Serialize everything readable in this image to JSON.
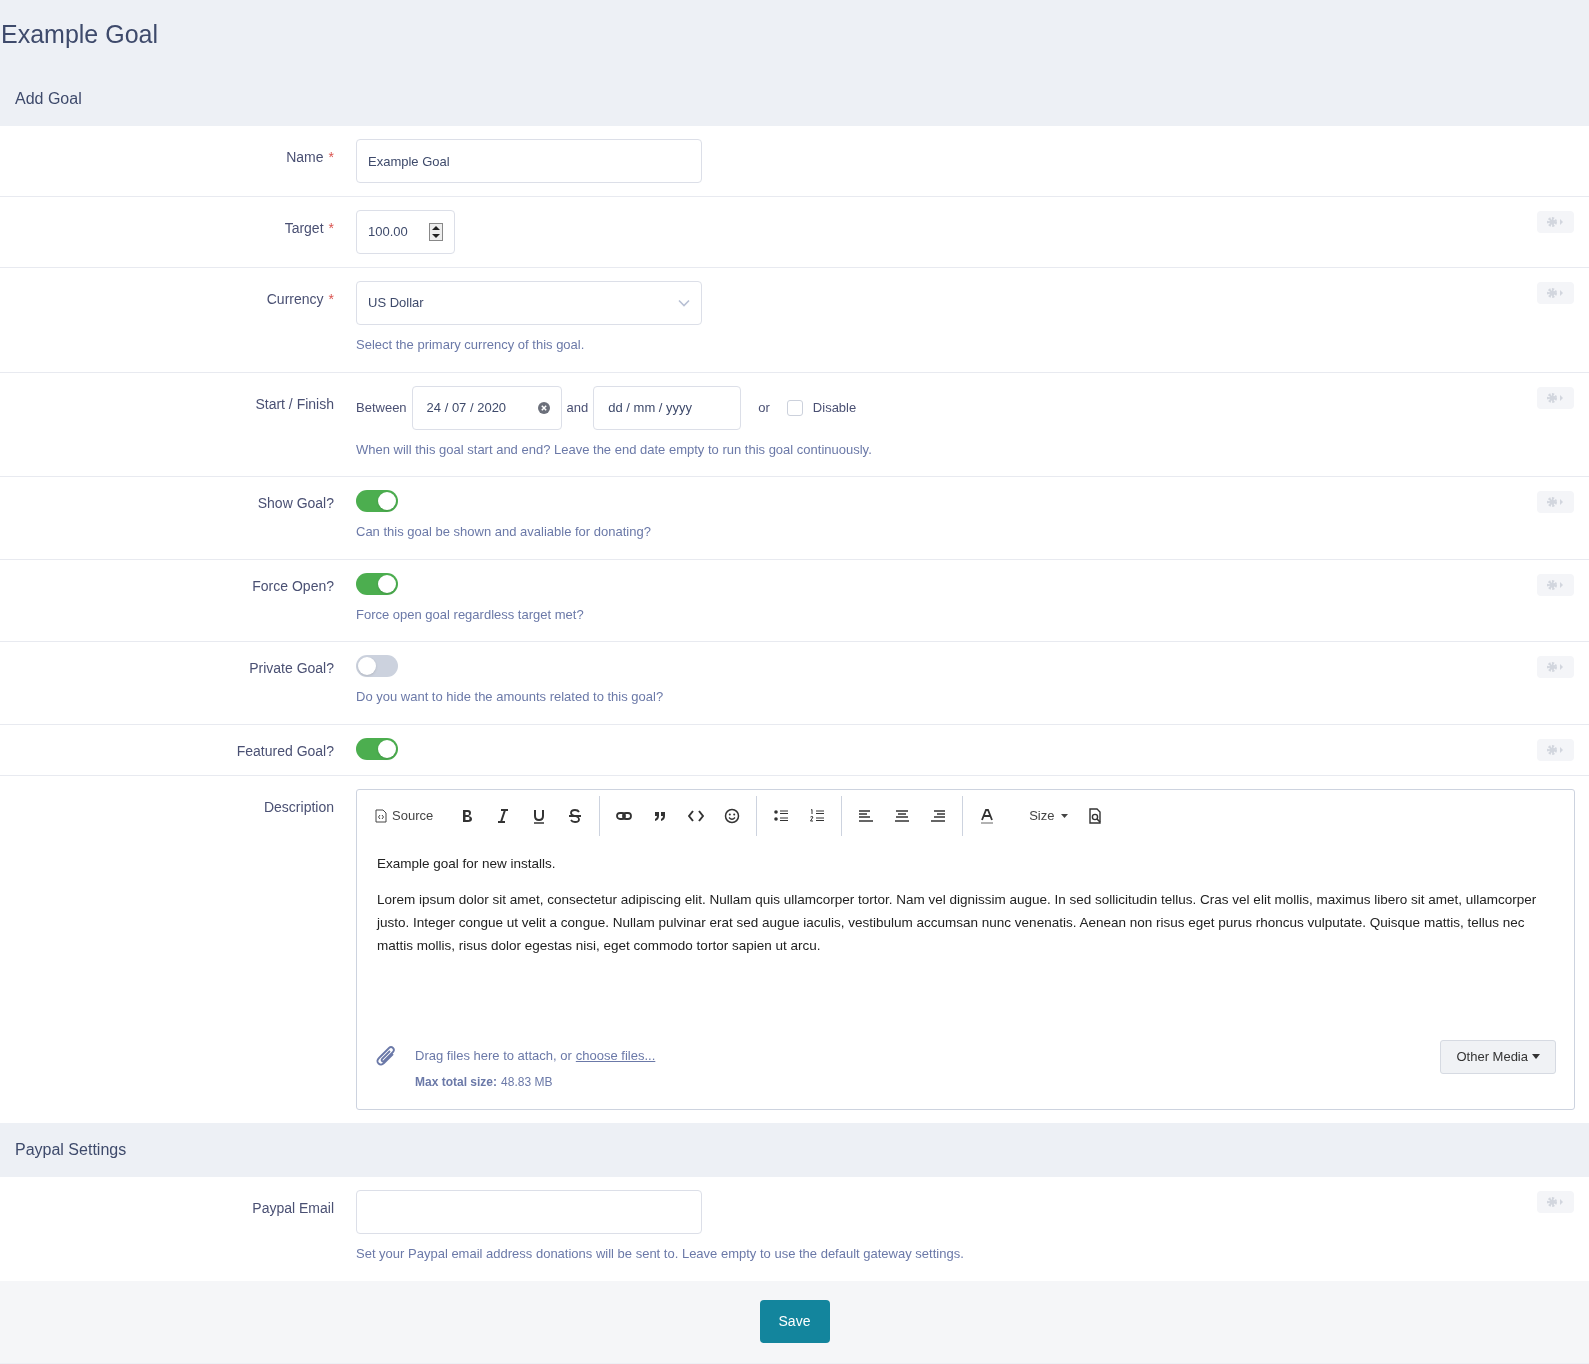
{
  "page_title": "Example Goal",
  "sections": [
    {
      "title": "Add Goal",
      "rows": [
        {
          "kind": "text",
          "label": "Name",
          "required_mark": "*",
          "value": "Example Goal",
          "settings_button": false
        },
        {
          "kind": "number",
          "label": "Target",
          "required_mark": "*",
          "value": "100.00",
          "settings_button": true
        },
        {
          "kind": "select",
          "label": "Currency",
          "required_mark": "*",
          "value": "US Dollar",
          "help": "Select the primary currency of this goal.",
          "settings_button": true
        },
        {
          "kind": "daterange",
          "label": "Start / Finish",
          "between": "Between",
          "start": "24 / 07 / 2020",
          "and": "and",
          "end_placeholder": "dd / mm / yyyy",
          "or": "or",
          "disable_label": "Disable",
          "disable_checked": false,
          "help": "When will this goal start and end? Leave the end date empty to run this goal continuously.",
          "settings_button": true
        },
        {
          "kind": "toggle",
          "label": "Show Goal?",
          "on": true,
          "help": "Can this goal be shown and avaliable for donating?",
          "settings_button": true
        },
        {
          "kind": "toggle",
          "label": "Force Open?",
          "on": true,
          "help": "Force open goal regardless target met?",
          "settings_button": true
        },
        {
          "kind": "toggle",
          "label": "Private Goal?",
          "on": false,
          "help": "Do you want to hide the amounts related to this goal?",
          "settings_button": true
        },
        {
          "kind": "toggle",
          "label": "Featured Goal?",
          "on": true,
          "settings_button": true
        },
        {
          "kind": "editor",
          "label": "Description",
          "source_label": "Source",
          "size_label": "Size",
          "paragraphs": [
            "Example goal for new installs.",
            "Lorem ipsum dolor sit amet, consectetur adipiscing elit. Nullam quis ullamcorper tortor. Nam vel dignissim augue. In sed sollicitudin tellus. Cras vel elit mollis, maximus libero sit amet, ullamcorper justo. Integer congue ut velit a congue. Nullam pulvinar erat sed augue iaculis, vestibulum accumsan nunc venenatis. Aenean non risus eget purus rhoncus vulputate. Quisque mattis, tellus nec mattis mollis, risus dolor egestas nisi, eget commodo tortor sapien ut arcu."
          ],
          "attach_text": "Drag files here to attach, or",
          "attach_link": "choose files...",
          "max_size_label": "Max total size:",
          "max_size_value": "48.83 MB",
          "other_media": "Other Media",
          "settings_button": false
        }
      ]
    },
    {
      "title": "Paypal Settings",
      "rows": [
        {
          "kind": "text",
          "label": "Paypal Email",
          "value": "",
          "help": "Set your Paypal email address donations will be sent to. Leave empty to use the default gateway settings.",
          "settings_button": true
        }
      ]
    }
  ],
  "save_button": "Save"
}
